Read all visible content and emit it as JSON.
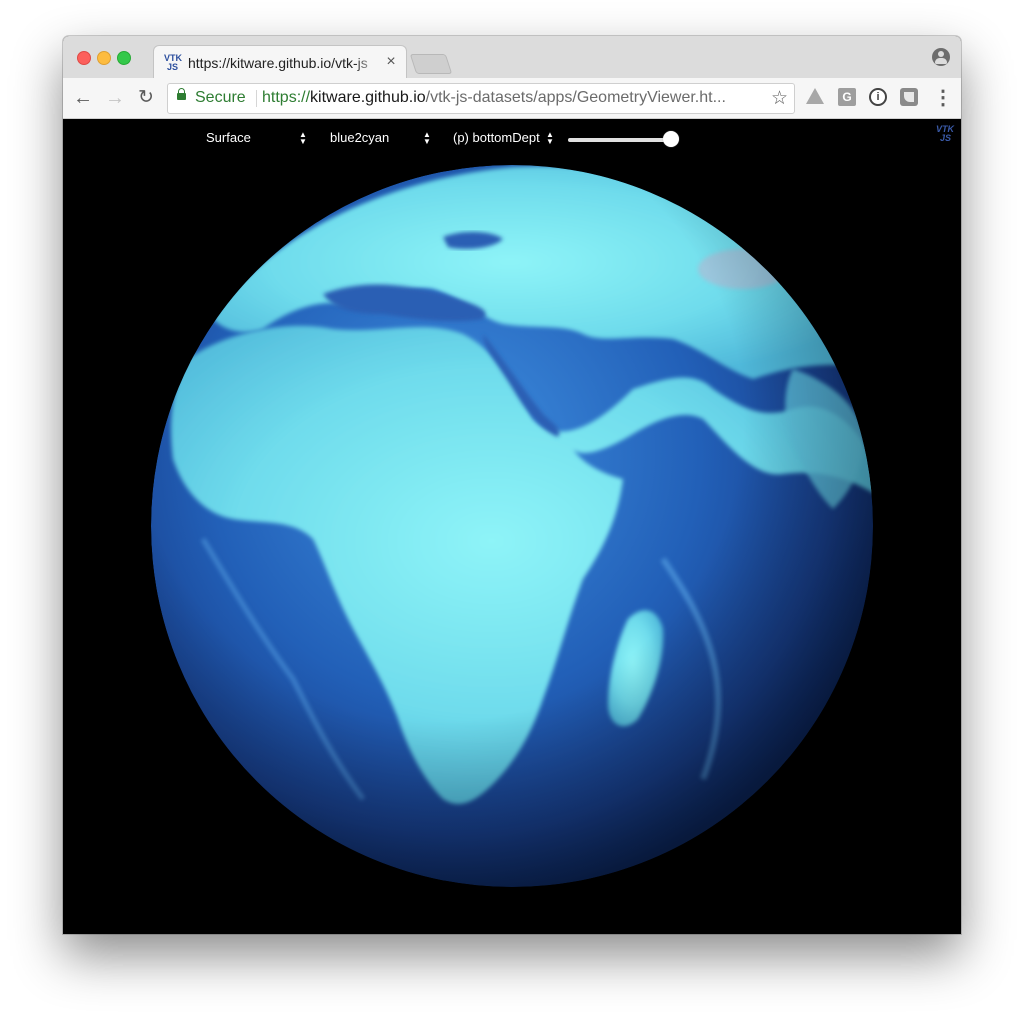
{
  "browser": {
    "tab": {
      "title": "https://kitware.github.io/vtk-js",
      "favicon_text_top": "VTK",
      "favicon_text_bottom": "JS",
      "close_glyph": "×"
    },
    "toolbar": {
      "back_glyph": "←",
      "forward_glyph": "→",
      "reload_glyph": "↻",
      "secure_label": "Secure",
      "url_scheme": "https://",
      "url_host": "kitware.github.io",
      "url_path": "/vtk-js-datasets/apps/GeometryViewer.ht...",
      "star_glyph": "☆",
      "ext_g_label": "G",
      "ext_info_label": "i",
      "menu_glyph": "⋮"
    },
    "icons": [
      "profile-icon",
      "lock-icon",
      "star-icon",
      "drive-icon",
      "g-extension-icon",
      "info-extension-icon",
      "square-extension-icon",
      "menu-icon"
    ]
  },
  "viewer": {
    "representation": "Surface",
    "colormap": "blue2cyan",
    "color_by": "(p) bottomDept",
    "opacity_slider_value": 1.0,
    "logo_top": "VTK",
    "logo_bottom": "JS"
  },
  "colors": {
    "ocean_deep": "#1a4fa8",
    "land_cyan": "#7fe8f0",
    "background": "#000000",
    "secure_green": "#2e7d32"
  }
}
